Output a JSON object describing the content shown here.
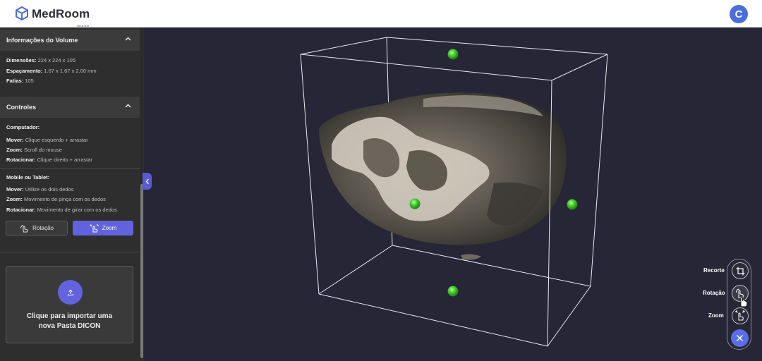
{
  "header": {
    "brand": "MedRoom",
    "brand_sub": "IMAGE",
    "avatar_initial": "C",
    "accent_color": "#4a6ee0"
  },
  "sidebar": {
    "volume_section": {
      "title": "Informações do Volume",
      "dimensions_label": "Dimensões:",
      "dimensions_value": "224 x 224 x 105",
      "spacing_label": "Espaçamento:",
      "spacing_value": "1.67 x 1.67 x 2.00 mm",
      "slices_label": "Fatias:",
      "slices_value": "105"
    },
    "controls_section": {
      "title": "Controles",
      "computer_heading": "Computador:",
      "computer": [
        {
          "label": "Mover:",
          "value": "Clique esquerdo + arrastar"
        },
        {
          "label": "Zoom:",
          "value": "Scroll do mouse"
        },
        {
          "label": "Rotacionar:",
          "value": "Clique direito + arrastar"
        }
      ],
      "mobile_heading": "Mobile ou Tablet:",
      "mobile": [
        {
          "label": "Mover:",
          "value": "Utilize os dois dedos"
        },
        {
          "label": "Zoom:",
          "value": "Movimento de pinça com os dedos"
        },
        {
          "label": "Rotacionar:",
          "value": "Movimento de girar com os dedos"
        }
      ],
      "rotation_button": "Rotação",
      "zoom_button": "Zoom"
    },
    "import": {
      "line1": "Clique para importar uma",
      "line2": "nova Pasta DICON"
    }
  },
  "toolbar": {
    "crop_label": "Recorte",
    "rotation_label": "Rotação",
    "zoom_label": "Zoom"
  },
  "colors": {
    "viewport_bg": "#262636",
    "sidebar_bg": "#2e2e2e",
    "button_accent": "#6262dd",
    "handle_green": "#3ecc2a"
  }
}
